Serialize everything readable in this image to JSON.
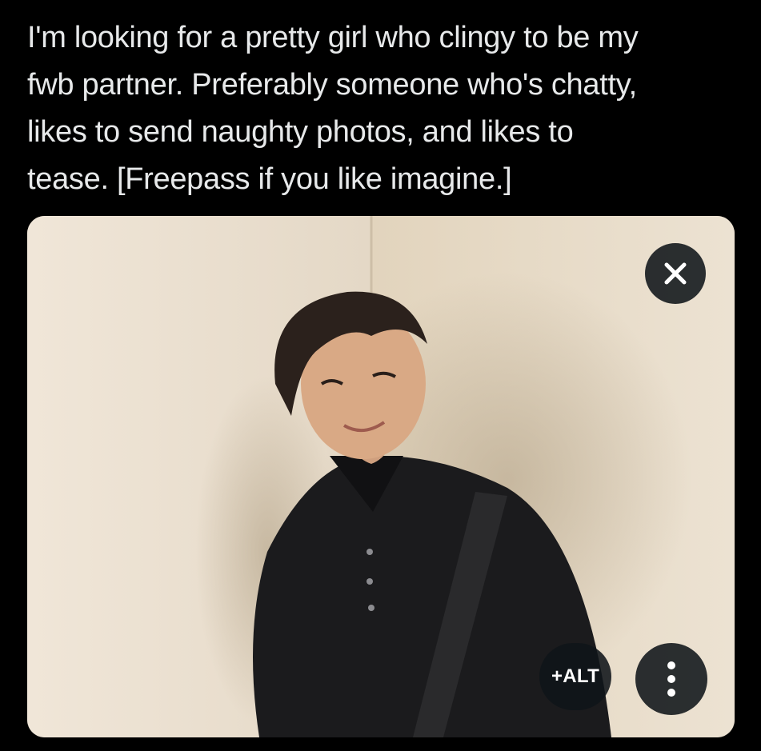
{
  "compose": {
    "text": "I'm looking for a pretty girl who clingy to be my\nfwb partner. Preferably someone who's chatty,\nlikes to send naughty photos, and likes to\ntease. [Freepass if you like imagine.]"
  },
  "media": {
    "remove_icon": "close-icon",
    "alt_label": "+ALT",
    "more_icon": "more-vertical-icon"
  },
  "colors": {
    "background": "#000000",
    "text": "#e7e9ea",
    "button_bg": "#0f1419"
  }
}
